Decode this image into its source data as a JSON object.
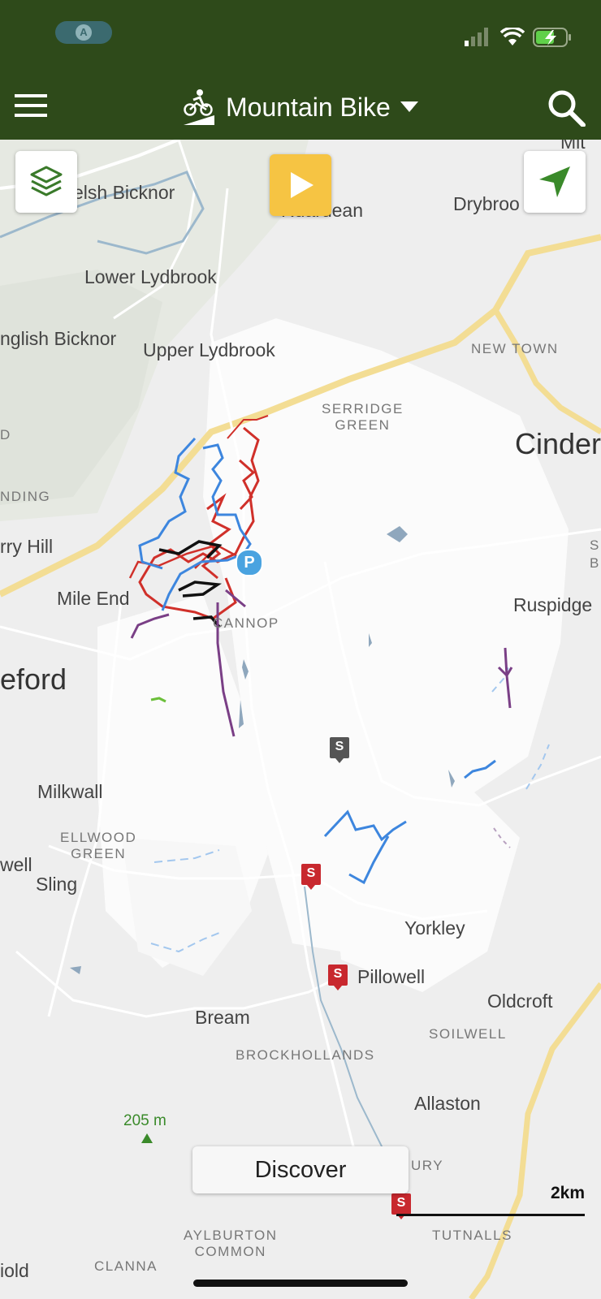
{
  "app_bar": {
    "title": "Mountain Bike"
  },
  "map": {
    "places": {
      "welsh_bicknor": "elsh Bicknor",
      "ruardean": "Ruardean",
      "drybrook": "Drybroo",
      "mitcheldean": "Mit",
      "lower_lydbrook": "Lower Lydbrook",
      "english_bicknor": "nglish Bicknor",
      "upper_lydbrook": "Upper Lydbrook",
      "new_town": "NEW TOWN",
      "serridge_green": "SERRIDGE\nGREEN",
      "cinderford": "Cinder",
      "d_edge": "D",
      "nding": "NDING",
      "berry_hill": "rry Hill",
      "mile_end": "Mile End",
      "ruspidge": "Ruspidge",
      "b_edge": "B",
      "s_edge": "S",
      "cannop": "CANNOP",
      "coleford": "eford",
      "milkwall": "Milkwall",
      "ellwood_green": "ELLWOOD\nGREEN",
      "sling": "Sling",
      "well_edge": "well",
      "yorkley": "Yorkley",
      "pillowell": "Pillowell",
      "oldcroft": "Oldcroft",
      "bream": "Bream",
      "soilwell": "SOILWELL",
      "brockhollands": "BROCKHOLLANDS",
      "allaston": "Allaston",
      "ury": "URY",
      "aylburton_common": "AYLBURTON\nCOMMON",
      "tutnalls": "TUTNALLS",
      "clanna": "CLANNA",
      "iold": "iold"
    },
    "elevation": "205 m",
    "parking_label": "P",
    "pin_label": "S"
  },
  "discover_label": "Discover",
  "scale_label": "2km",
  "colors": {
    "header": "#2e4a1a",
    "play": "#f6c443",
    "trail_red": "#d0302a",
    "trail_blue": "#3d86de",
    "trail_black": "#111111",
    "trail_purple": "#7a3f86",
    "road_yellow": "#f3dd94",
    "water": "#9cb8cc"
  },
  "icons": [
    "layers-icon",
    "play-icon",
    "navigation-arrow-icon",
    "menu-icon",
    "search-icon",
    "mountain-bike-icon",
    "dropdown-caret-icon",
    "signal-icon",
    "wifi-icon",
    "battery-icon"
  ]
}
